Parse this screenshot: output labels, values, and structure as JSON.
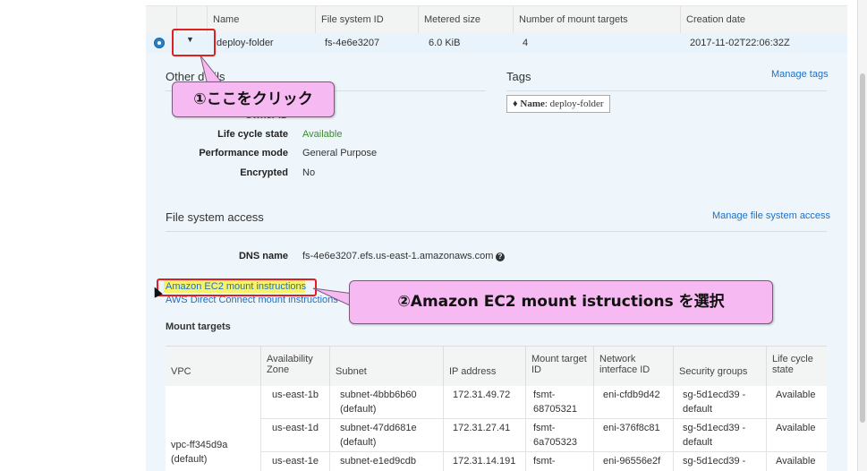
{
  "filesystems_table": {
    "columns": [
      "Name",
      "File system ID",
      "Metered size",
      "Number of mount targets",
      "Creation date"
    ],
    "row": {
      "name": "deploy-folder",
      "id": "fs-4e6e3207",
      "metered_size": "6.0 KiB",
      "mount_targets": "4",
      "creation_date": "2017-11-02T22:06:32Z"
    }
  },
  "other_details": {
    "title": "Other details",
    "title_visible": "Other d",
    "title_tail": "ails",
    "owner_label": "Owner ID",
    "lifecycle_label": "Life cycle state",
    "lifecycle_value": "Available",
    "performance_label": "Performance mode",
    "performance_value": "General Purpose",
    "encrypted_label": "Encrypted",
    "encrypted_value": "No"
  },
  "tags": {
    "title": "Tags",
    "manage_link": "Manage tags",
    "tag_key": "Name",
    "tag_value": ": deploy-folder"
  },
  "access": {
    "title": "File system access",
    "manage_link": "Manage file system access",
    "dns_label": "DNS name",
    "dns_value": "fs-4e6e3207.efs.us-east-1.amazonaws.com",
    "ec2_link": "Amazon EC2 mount instructions",
    "direct_connect_link": "AWS Direct Connect mount instructions"
  },
  "mount_targets": {
    "title": "Mount targets",
    "headers": {
      "vpc": "VPC",
      "az_1": "Availability",
      "az_2": "Zone",
      "subnet": "Subnet",
      "ip": "IP address",
      "mtid_1": "Mount target",
      "mtid_2": "ID",
      "eni_1": "Network",
      "eni_2": "interface ID",
      "sg": "Security groups",
      "lc_1": "Life cycle",
      "lc_2": "state"
    },
    "vpc_1": "vpc-ff345d9a",
    "vpc_2": "(default)",
    "rows": [
      {
        "az": "us-east-1b",
        "subnet_1": "subnet-4bbb6b60",
        "subnet_2": "(default)",
        "ip": "172.31.49.72",
        "mt_1": "fsmt-",
        "mt_2": "68705321",
        "eni": "eni-cfdb9d42",
        "sg_1": "sg-5d1ecd39 -",
        "sg_2": "default",
        "state": "Available"
      },
      {
        "az": "us-east-1d",
        "subnet_1": "subnet-47dd681e",
        "subnet_2": "(default)",
        "ip": "172.31.27.41",
        "mt_1": "fsmt-",
        "mt_2": "6a705323",
        "eni": "eni-376f8c81",
        "sg_1": "sg-5d1ecd39 -",
        "sg_2": "default",
        "state": "Available"
      },
      {
        "az": "us-east-1e",
        "subnet_1": "subnet-e1ed9cdb",
        "subnet_2": "",
        "ip": "172.31.14.191",
        "mt_1": "fsmt-",
        "mt_2": "",
        "eni": "eni-96556e2f",
        "sg_1": "sg-5d1ecd39 -",
        "sg_2": "",
        "state": "Available"
      }
    ]
  },
  "annotations": {
    "callout_1": "①ここをクリック",
    "callout_2": "②Amazon EC2 mount istructions を選択"
  },
  "colors": {
    "callout_bg": "#f7b9f2",
    "highlight_box": "#e02020",
    "link": "#1f6fc5",
    "available": "#3c8a2e",
    "selected_row": "#e9f3fb"
  },
  "icons": {
    "expand": "caret-down-icon",
    "tag": "tag-icon",
    "help": "question-circle-icon",
    "radio": "radio-selected-icon"
  }
}
